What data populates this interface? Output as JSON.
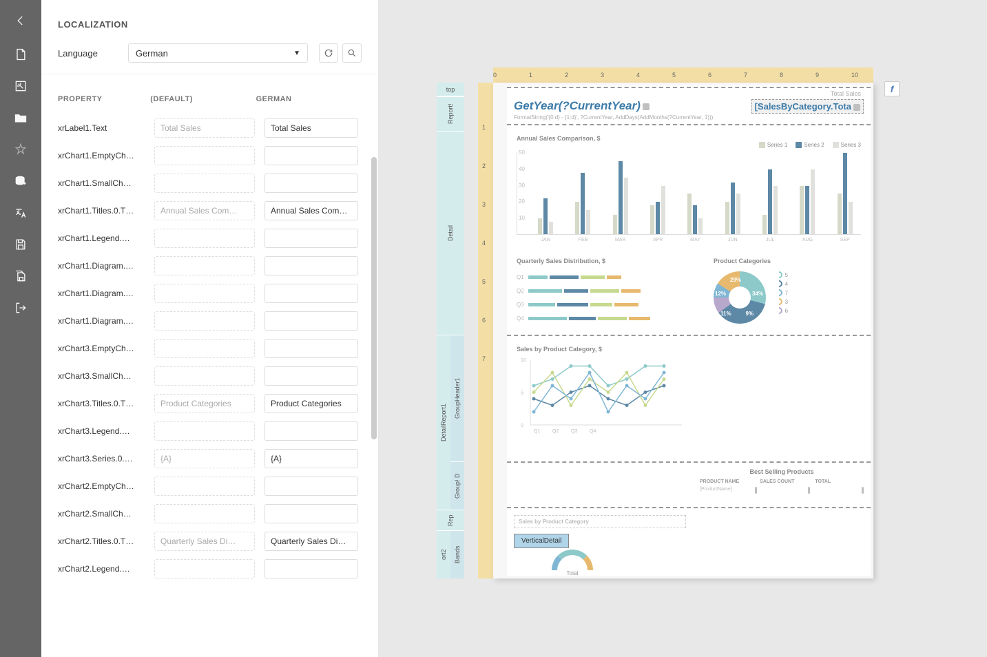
{
  "panel": {
    "title": "LOCALIZATION",
    "language_label": "Language",
    "language_value": "German",
    "headings": {
      "property": "PROPERTY",
      "default": "(DEFAULT)",
      "translated": "GERMAN"
    },
    "rows": [
      {
        "prop": "xrLabel1.Text",
        "def": "Total Sales",
        "val": "Total Sales"
      },
      {
        "prop": "xrChart1.EmptyCh…",
        "def": "",
        "val": ""
      },
      {
        "prop": "xrChart1.SmallCh…",
        "def": "",
        "val": ""
      },
      {
        "prop": "xrChart1.Titles.0.T…",
        "def": "Annual Sales Com…",
        "val": "Annual Sales Com…"
      },
      {
        "prop": "xrChart1.Legend.…",
        "def": "",
        "val": ""
      },
      {
        "prop": "xrChart1.Diagram.…",
        "def": "",
        "val": ""
      },
      {
        "prop": "xrChart1.Diagram.…",
        "def": "",
        "val": ""
      },
      {
        "prop": "xrChart1.Diagram.…",
        "def": "",
        "val": ""
      },
      {
        "prop": "xrChart3.EmptyCh…",
        "def": "",
        "val": ""
      },
      {
        "prop": "xrChart3.SmallCh…",
        "def": "",
        "val": ""
      },
      {
        "prop": "xrChart3.Titles.0.T…",
        "def": "Product Categories",
        "val": "Product Categories"
      },
      {
        "prop": "xrChart3.Legend.…",
        "def": "",
        "val": ""
      },
      {
        "prop": "xrChart3.Series.0.…",
        "def": "{A}",
        "val": "{A}"
      },
      {
        "prop": "xrChart2.EmptyCh…",
        "def": "",
        "val": ""
      },
      {
        "prop": "xrChart2.SmallCh…",
        "def": "",
        "val": ""
      },
      {
        "prop": "xrChart2.Titles.0.T…",
        "def": "Quarterly Sales Di…",
        "val": "Quarterly Sales Di…"
      },
      {
        "prop": "xrChart2.Legend.…",
        "def": "",
        "val": ""
      }
    ]
  },
  "ruler_h": [
    "0",
    "1",
    "2",
    "3",
    "4",
    "5",
    "6",
    "7",
    "8",
    "9",
    "10"
  ],
  "ruler_v": [
    "1",
    "2",
    "3",
    "4",
    "5",
    "6",
    "7"
  ],
  "bands": {
    "top": "top",
    "report": "Report!",
    "detail": "Detail",
    "detailreport": "DetailReport1",
    "groupheader": "GroupHeader1",
    "groupd": "Group! D",
    "reportf": "Rep",
    "sub": "ort2",
    "vbands": "Bands"
  },
  "preview": {
    "total_sales_label": "Total Sales",
    "year_expr": "GetYear(?CurrentYear)",
    "total_expr": "[SalesByCategory.Tota",
    "sub_expr": "FormatString('{0:d} - {1:d}', ?CurrentYear, AddDays(AddMonths(?CurrentYear, 1)))",
    "sub_tab": "VerticalDetail",
    "sub_header_text": "Sales by Product Category",
    "bsp": {
      "title": "Best Selling Products",
      "cols": [
        "PRODUCT NAME",
        "SALES COUNT",
        "TOTAL"
      ],
      "vals": [
        "[ProductName]",
        "",
        ""
      ]
    },
    "gauge_label": "Total"
  },
  "chart_data": [
    {
      "type": "bar",
      "title": "Annual Sales Comparison, $",
      "categories": [
        "JAN",
        "FEB",
        "MAR",
        "APR",
        "MAY",
        "JUN",
        "JUL",
        "AUG",
        "SEP"
      ],
      "series": [
        {
          "name": "Series 1",
          "color": "#d5d9c8",
          "values": [
            10,
            20,
            12,
            18,
            25,
            20,
            12,
            30,
            25
          ]
        },
        {
          "name": "Series 2",
          "color": "#5d88a6",
          "values": [
            22,
            38,
            45,
            20,
            18,
            32,
            40,
            30,
            50
          ]
        },
        {
          "name": "Series 3",
          "color": "#e0e1dc",
          "values": [
            8,
            15,
            35,
            30,
            10,
            25,
            30,
            40,
            20
          ]
        }
      ],
      "ylim": [
        0,
        50
      ],
      "yticks": [
        10,
        20,
        30,
        40,
        50
      ]
    },
    {
      "type": "bar",
      "orientation": "horizontal",
      "title": "Quarterly Sales Distribution, $",
      "categories": [
        "Q1",
        "Q2",
        "Q3",
        "Q4"
      ],
      "series": [
        {
          "color": "#8dc9c9",
          "values": [
            40,
            70,
            55,
            80
          ]
        },
        {
          "color": "#5d88a6",
          "values": [
            60,
            50,
            65,
            55
          ]
        },
        {
          "color": "#c6d98e",
          "values": [
            50,
            60,
            45,
            60
          ]
        },
        {
          "color": "#e7b96e",
          "values": [
            30,
            40,
            50,
            45
          ]
        }
      ]
    },
    {
      "type": "pie",
      "title": "Product Categories",
      "slices": [
        {
          "label": "5",
          "value": 29,
          "color": "#8dc9c9"
        },
        {
          "label": "4",
          "value": 34,
          "color": "#5d88a6"
        },
        {
          "label": "7",
          "value": 9,
          "color": "#7fb6d4"
        },
        {
          "label": "3",
          "value": 11,
          "color": "#e7b96e"
        },
        {
          "label": "6",
          "value": 12,
          "color": "#b8a9cc"
        }
      ]
    },
    {
      "type": "line",
      "title": "Sales by Product Category, $",
      "x": [
        "Q1",
        "Q2",
        "Q3",
        "Q4"
      ],
      "series": [
        {
          "color": "#8dc9c9",
          "values": [
            6,
            7,
            9,
            9
          ]
        },
        {
          "color": "#5d88a6",
          "values": [
            4,
            3,
            5,
            6
          ]
        },
        {
          "color": "#c6d98e",
          "values": [
            5,
            8,
            3,
            7
          ]
        },
        {
          "color": "#7fb6d4",
          "values": [
            2,
            6,
            4,
            8
          ]
        }
      ],
      "ylim": [
        0,
        10
      ],
      "yticks": [
        0,
        5,
        10
      ]
    }
  ]
}
